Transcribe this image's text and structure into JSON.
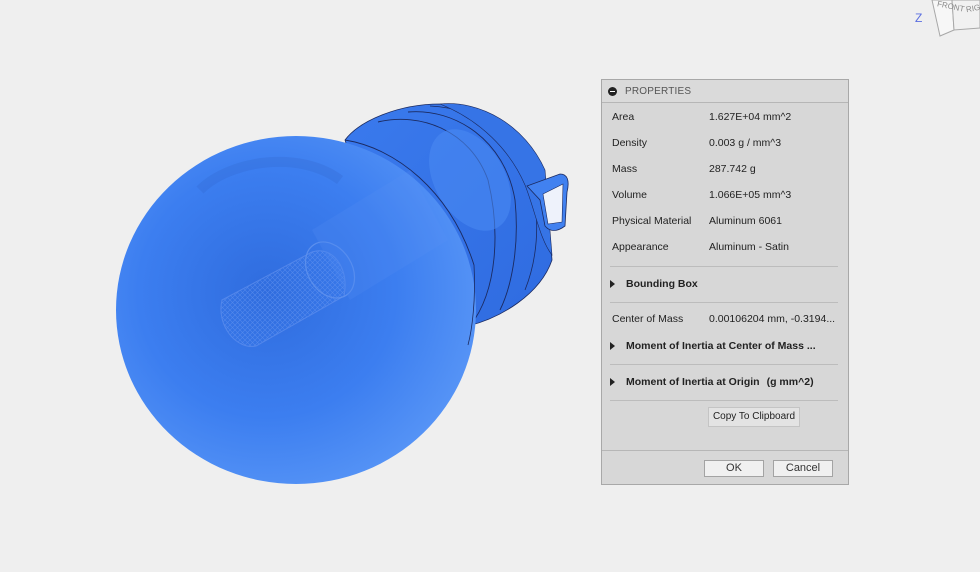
{
  "viewcube": {
    "axis_label": "Z",
    "face_front": "FRONT",
    "face_right": "RIG"
  },
  "panel": {
    "title": "PROPERTIES",
    "properties": [
      {
        "label": "Area",
        "value": "1.627E+04 mm^2"
      },
      {
        "label": "Density",
        "value": "0.003 g / mm^3"
      },
      {
        "label": "Mass",
        "value": "287.742 g"
      },
      {
        "label": "Volume",
        "value": "1.066E+05 mm^3"
      },
      {
        "label": "Physical Material",
        "value": "Aluminum 6061"
      },
      {
        "label": "Appearance",
        "value": "Aluminum - Satin"
      }
    ],
    "bounding_box": "Bounding Box",
    "center_of_mass": {
      "label": "Center of Mass",
      "value": "0.00106204 mm, -0.3194..."
    },
    "moi_center": "Moment of Inertia at Center of Mass ...",
    "moi_origin": "Moment of Inertia at Origin",
    "moi_origin_units": "(g mm^2)",
    "copy_button": "Copy To Clipboard",
    "ok_button": "OK",
    "cancel_button": "Cancel"
  },
  "colors": {
    "model_fill": "#3f7ef0",
    "panel_bg": "#d7d7d7",
    "viewport_bg": "#efefef"
  }
}
